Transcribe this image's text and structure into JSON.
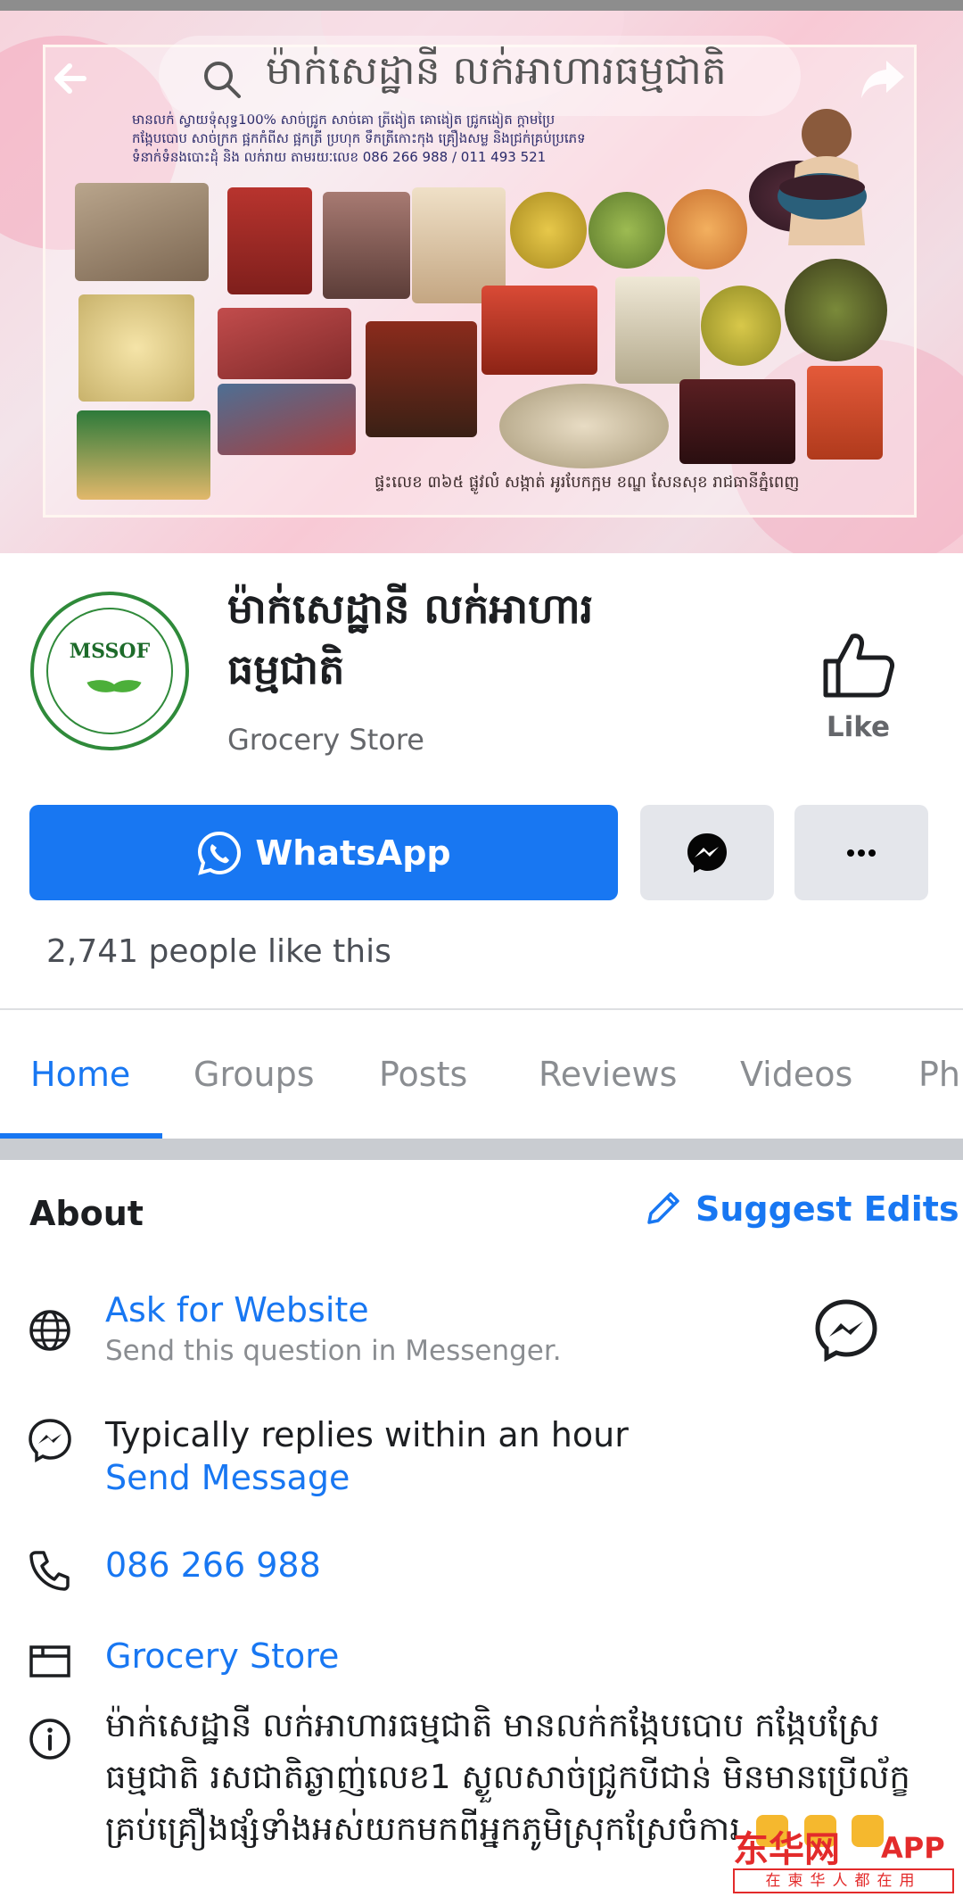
{
  "cover": {
    "title": "ម៉ាក់សេដ្ឋានី លក់អាហារធម្មជាតិ",
    "info_line_1": "មានលក់ ស្វាយទុំសុទ្ធ100% សាច់ជ្រូក សាច់គោ ត្រីងៀត គោងៀត ជ្រូកងៀត ក្តាមប្រៃ",
    "info_line_2": "កង្កែបបោប សាច់ក្រក ផ្អកកំពីស ផ្អកត្រី ប្រហុក ទឹកត្រីកោះកុង គ្រឿងសម្ល និងជ្រក់គ្រប់ប្រភេទ",
    "info_line_3": "ទំនាក់ទំនងបោះដុំ និង លក់រាយ តាមរយៈលេខ 086 266 988 / 011 493 521",
    "address": "ផ្ទះលេខ ៣៦៥ ផ្លូវលំ សង្កាត់ អូរបែកក្អម ខណ្ឌ សែនសុខ រាជធានីភ្នំពេញ"
  },
  "profile": {
    "logo_text": "MSSOF",
    "name": "ម៉ាក់សេដ្ឋានី លក់អាហារធម្មជាតិ",
    "category": "Grocery Store",
    "like_label": "Like"
  },
  "actions": {
    "whatsapp_label": "WhatsApp",
    "likes_text": "2,741 people like this"
  },
  "tabs": [
    "Home",
    "Groups",
    "Posts",
    "Reviews",
    "Videos",
    "Ph"
  ],
  "about": {
    "title": "About",
    "suggest_label": "Suggest Edits",
    "website_link": "Ask for Website",
    "website_sub": "Send this question in Messenger.",
    "reply_text": "Typically replies within an hour",
    "send_message": "Send Message",
    "phone": "086 266 988",
    "category_link": "Grocery Store",
    "description": "ម៉ាក់សេដ្ឋានី លក់អាហារធម្មជាតិ មានលក់កង្កែបបោប កង្កែបស្រែធម្មជាតិ រសជាតិឆ្ងាញ់លេខ1 ស្ងួលសាច់ជ្រូកបីជាន់ មិនមានប្រើល័ក្ខ គ្រប់គ្រឿងផ្សំទាំងអស់យកមកពីអ្នកភូមិស្រុកស្រែចំការ"
  },
  "watermark": {
    "main": "东华网",
    "app": "APP",
    "sub": "在柬华人都在用"
  },
  "colors": {
    "accent": "#1877f2",
    "text_secondary": "#65676b",
    "button_grey": "#e4e6eb",
    "watermark": "#e32b2b"
  }
}
